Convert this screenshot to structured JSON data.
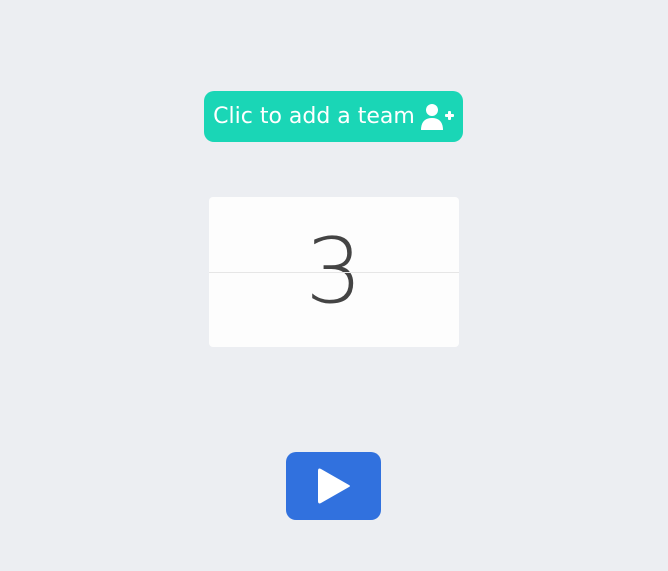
{
  "add_team_button": {
    "label": "Clic to add a team",
    "icon": "user-plus-icon",
    "color": "#1ad6b6"
  },
  "counter": {
    "value": "3"
  },
  "play_button": {
    "icon": "play-icon",
    "color": "#3171de"
  },
  "background_color": "#eceef2"
}
